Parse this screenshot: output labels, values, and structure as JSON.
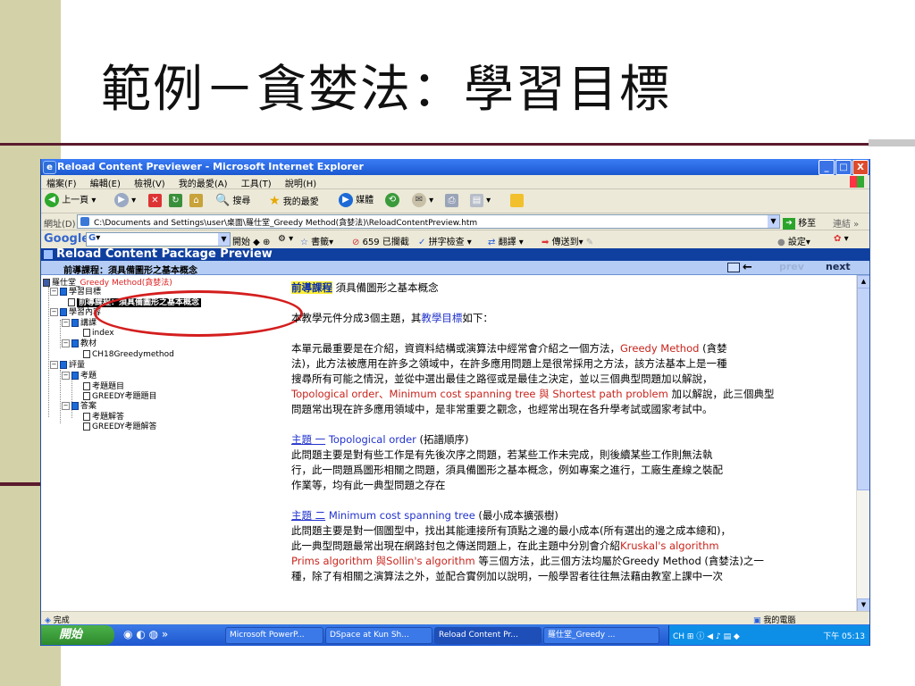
{
  "slide": {
    "title": "範例－貪婪法：學習目標"
  },
  "window": {
    "title": "Reload Content Previewer - Microsoft Internet Explorer",
    "buttons": {
      "minimize": "_",
      "maximize": "□",
      "close": "X"
    }
  },
  "menu": [
    "檔案(F)",
    "編輯(E)",
    "檢視(V)",
    "我的最愛(A)",
    "工具(T)",
    "說明(H)"
  ],
  "toolbar": {
    "back": "上一頁",
    "search": "搜尋",
    "favorites": "我的最愛",
    "media": "媒體"
  },
  "address": {
    "label": "網址(D)",
    "value": "C:\\Documents and Settings\\user\\桌面\\羅仕堂_Greedy Method(貪婪法)\\ReloadContentPreview.htm",
    "go": "移至",
    "links": "連結"
  },
  "google": {
    "logo": "Google",
    "search_prefix": "G",
    "open": "開始",
    "bookmarks": "書籤",
    "blocked": "659 已攔截",
    "spell": "拼字檢查",
    "translate": "翻譯",
    "send": "傳送到",
    "settings": "設定"
  },
  "app": {
    "header": "Reload Content Package Preview",
    "subheader": "前導課程：須具備圖形之基本概念",
    "prev": "prev",
    "next": "next"
  },
  "tree": {
    "root_prefix": "羅仕堂_",
    "root_suffix": "Greedy Method(貪婪法)",
    "items": [
      "學習目標",
      "前導課程：須具備圖形之基本概念",
      "學習內容",
      "講課",
      "index",
      "教材",
      "CH18Greedymethod",
      "評量",
      "考題",
      "考題題目",
      "GREEDY考題題目",
      "答案",
      "考題解答",
      "GREEDY考題解答"
    ]
  },
  "content": {
    "heading_tag": "前導課程",
    "heading_text": "須具備圖形之基本概念",
    "intro_a": "本教學元件分成3個主題，其",
    "intro_link": "教學目標",
    "intro_b": "如下：",
    "p1_l1a": "本單元最重要是在介紹，資資料結構或演算法中經常會介紹之一個方法，",
    "p1_l1b": "Greedy Method",
    "p1_l1c": " (貪婪",
    "p1_l2": "法)，此方法被應用在許多之領域中，在許多應用問題上是很常採用之方法，該方法基本上是一種",
    "p1_l3": "搜尋所有可能之情況，並從中選出最佳之路徑或是最佳之決定，並以三個典型問題加以解說，",
    "p1_l4a": "Topological order、Minimum cost spanning tree 與 Shortest path problem",
    "p1_l4b": " 加以解說，此三個典型",
    "p1_l5": "問題常出現在許多應用領域中，是非常重要之觀念，也經常出現在各升學考試或國家考試中。",
    "t1_label": "主題 一",
    "t1_title": "Topological order",
    "t1_paren": " (拓譜順序)",
    "t1_l1": "此問題主要是對有些工作是有先後次序之問題，若某些工作未完成，則後續某些工作則無法執",
    "t1_l2": "行，此一問題爲圖形相關之問題，須具備圖形之基本概念，例如專案之進行，工廠生產線之裝配",
    "t1_l3": "作業等，均有此一典型問題之存在",
    "t2_label": "主題 二",
    "t2_title": "Minimum cost spanning tree",
    "t2_paren": " (最小成本擴張樹)",
    "t2_l1": "此問題主要是對一個圖型中，找出其能連接所有頂點之邊的最小成本(所有選出的邊之成本總和)，",
    "t2_l2a": "此一典型問題最常出現在網路封包之傳送問題上，在此主題中分別會介紹",
    "t2_l2b": "Kruskal's algorithm",
    "t2_l3a": "Prims algorithm 與Sollin's algorithm",
    "t2_l3b": " 等三個方法，此三個方法均屬於Greedy Method (貪婪法)之一",
    "t2_l4": "種，除了有相關之演算法之外，並配合實例加以說明，一般學習者往往無法藉由教室上課中一次"
  },
  "status": {
    "left": "完成",
    "zone": "我的電腦"
  },
  "taskbar": {
    "start": "開始",
    "tasks": [
      "Microsoft PowerP...",
      "DSpace at Kun Sh...",
      "Reload Content Pr...",
      "羅仕堂_Greedy ..."
    ],
    "lang": "CH",
    "clock": "下午 05:13"
  }
}
